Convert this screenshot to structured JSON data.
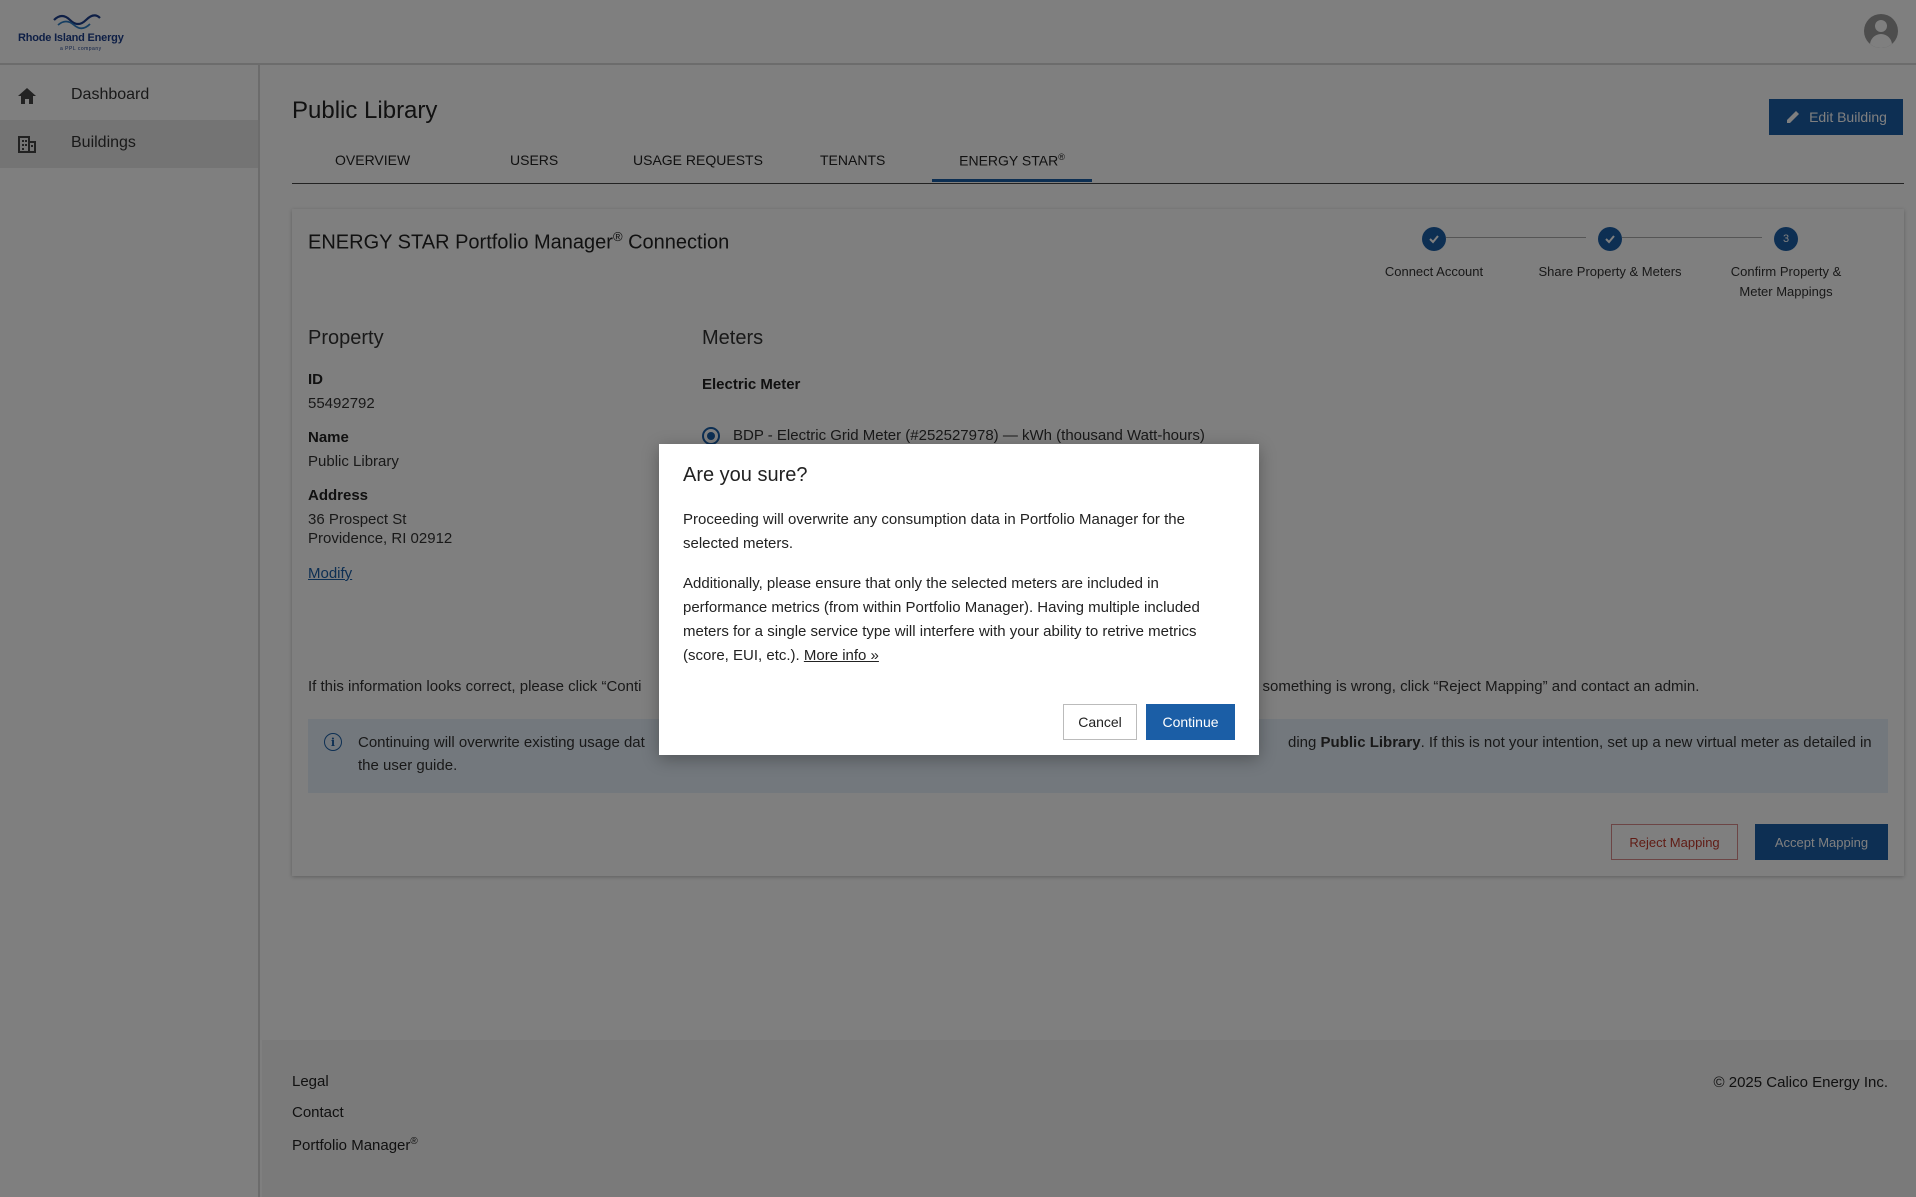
{
  "header": {
    "logo_text": "Rhode Island Energy",
    "logo_tagline": "a PPL company",
    "avatar_icon": "user-avatar-icon"
  },
  "sidebar": {
    "items": [
      {
        "label": "Dashboard",
        "icon": "home-icon"
      },
      {
        "label": "Buildings",
        "icon": "building-icon"
      }
    ]
  },
  "page": {
    "title": "Public Library",
    "edit_button": "Edit Building",
    "tabs": [
      {
        "label": "OVERVIEW"
      },
      {
        "label": "USERS"
      },
      {
        "label": "USAGE REQUESTS"
      },
      {
        "label": "TENANTS"
      },
      {
        "label": "ENERGY STAR",
        "sup": "®"
      }
    ]
  },
  "card": {
    "title": "ENERGY STAR Portfolio Manager",
    "title_sup": "®",
    "title_suffix": " Connection",
    "steps": [
      {
        "label": "Connect Account",
        "state": "done"
      },
      {
        "label": "Share Property & Meters",
        "state": "done"
      },
      {
        "label": "Confirm Property & Meter Mappings",
        "state": "current",
        "number": "3"
      }
    ],
    "property": {
      "heading": "Property",
      "id_label": "ID",
      "id_value": "55492792",
      "name_label": "Name",
      "name_value": "Public Library",
      "address_label": "Address",
      "address_line1": "36 Prospect St",
      "address_line2": "Providence, RI 02912",
      "modify_link": "Modify"
    },
    "meters": {
      "heading": "Meters",
      "electric_heading": "Electric Meter",
      "meter_option": "BDP - Electric Grid Meter (#252527978) — kWh (thousand Watt-hours)"
    },
    "confirm_text_left": "If this information looks correct, please click “Conti",
    "confirm_text_right": "If something is wrong, click “Reject Mapping” and contact an admin.",
    "info_text_left": "Continuing will overwrite existing usage dat",
    "info_text_mid": "ding ",
    "info_text_bold": "Public Library",
    "info_text_right": ". If this is not your intention, set up a new virtual meter as detailed in",
    "info_text_line2": "the user guide.",
    "reject_button": "Reject Mapping",
    "accept_button": "Accept Mapping"
  },
  "footer": {
    "legal": "Legal",
    "contact": "Contact",
    "portfolio": "Portfolio Manager",
    "portfolio_sup": "®",
    "copyright": "© 2025 Calico Energy Inc."
  },
  "modal": {
    "title": "Are you sure?",
    "paragraph1": "Proceeding will overwrite any consumption data in Portfolio Manager for the selected meters.",
    "paragraph2": "Additionally, please ensure that only the selected meters are included in performance metrics (from within Portfolio Manager). Having multiple included meters for a single service type will interfere with your ability to retrive metrics (score, EUI, etc.). ",
    "more_info": "More info »",
    "cancel_button": "Cancel",
    "continue_button": "Continue"
  },
  "colors": {
    "primary": "#1b5ea6",
    "danger": "#c0392b",
    "info_bg": "#e6f1fa"
  }
}
